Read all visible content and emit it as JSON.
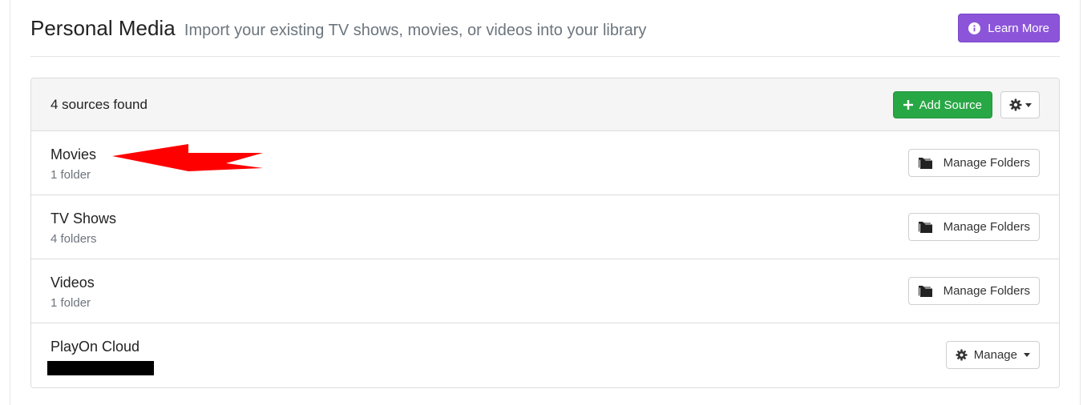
{
  "header": {
    "title": "Personal Media",
    "subtitle": "Import your existing TV shows, movies, or videos into your library",
    "learn_more_label": "Learn More"
  },
  "sources": {
    "count_label": "4 sources found",
    "add_source_label": "Add Source",
    "items": [
      {
        "name": "Movies",
        "detail": "1 folder",
        "action_label": "Manage Folders"
      },
      {
        "name": "TV Shows",
        "detail": "4 folders",
        "action_label": "Manage Folders"
      },
      {
        "name": "Videos",
        "detail": "1 folder",
        "action_label": "Manage Folders"
      },
      {
        "name": "PlayOn Cloud",
        "detail": "",
        "action_label": "Manage"
      }
    ]
  },
  "colors": {
    "learn_more_bg": "#8c55d9",
    "add_source_bg": "#28a745",
    "annotation_arrow": "#ff0000",
    "redaction": "#000000"
  },
  "icons": [
    "info-icon",
    "plus-icon",
    "gear-icon",
    "chevron-down-icon",
    "folders-icon",
    "arrow-annotation",
    "redaction-bar"
  ]
}
